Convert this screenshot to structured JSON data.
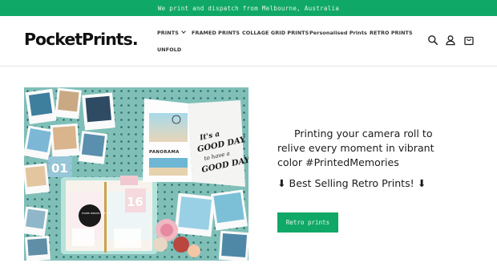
{
  "announcement": {
    "text": "We print and dispatch from Melbourne, Australia"
  },
  "header": {
    "logo": {
      "main": "PocketPrints",
      "dot": "."
    },
    "nav": [
      {
        "label": "PRINTS",
        "has_dropdown": true
      },
      {
        "label": "FRAMED PRINTS"
      },
      {
        "label": "COLLAGE GRID PRINTS"
      },
      {
        "label": "Personalised Prints"
      },
      {
        "label": "RETRO PRINTS"
      },
      {
        "label": "UNFOLD"
      }
    ],
    "icons": [
      "search-icon",
      "account-icon",
      "cart-icon"
    ]
  },
  "hero": {
    "headline": "Printing your camera roll to relive every moment in vibrant color #PrintedMemories",
    "subline": "⬇ Best Selling Retro Prints! ⬇",
    "cta_label": "Retro prints",
    "photo_text": {
      "badge_left": "01",
      "badge_right": "16",
      "book_label": "PANORAMA",
      "card_left": "It's a GOOD DAY to have a GOOD DAY!",
      "sticker": "make waves not war"
    }
  },
  "colors": {
    "accent": "#10a866",
    "text": "#121212"
  }
}
